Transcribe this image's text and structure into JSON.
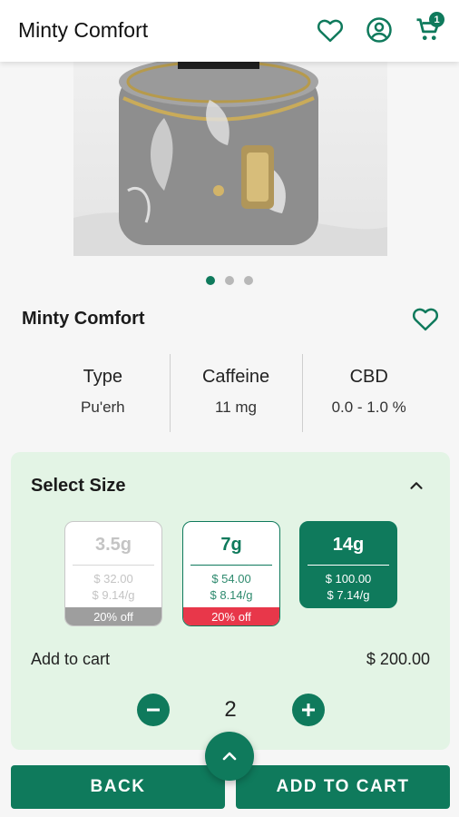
{
  "header": {
    "title": "Minty Comfort",
    "cart_count": "1"
  },
  "icons": {
    "favorite": "heart-icon",
    "account": "account-circle-icon",
    "cart": "cart-icon"
  },
  "gallery": {
    "slides": 3,
    "active_index": 0
  },
  "product": {
    "name": "Minty Comfort",
    "specs": [
      {
        "label": "Type",
        "value": "Pu'erh"
      },
      {
        "label": "Caffeine",
        "value": "11 mg"
      },
      {
        "label": "CBD",
        "value": "0.0 - 1.0 %"
      }
    ]
  },
  "size_selector": {
    "title": "Select Size",
    "options": [
      {
        "weight": "3.5g",
        "price": "$ 32.00",
        "unit_price": "$ 9.14/g",
        "badge": "20% off",
        "state": "disabled"
      },
      {
        "weight": "7g",
        "price": "$ 54.00",
        "unit_price": "$ 8.14/g",
        "badge": "20% off",
        "state": "available"
      },
      {
        "weight": "14g",
        "price": "$ 100.00",
        "unit_price": "$ 7.14/g",
        "badge": "",
        "state": "selected"
      }
    ],
    "add_to_cart_label": "Add to cart",
    "total": "$ 200.00",
    "quantity": "2"
  },
  "footer": {
    "back_label": "BACK",
    "add_label": "ADD TO CART"
  },
  "colors": {
    "accent": "#0f7a5c",
    "panel": "#e3f4e5",
    "discount_red": "#e8374a",
    "discount_grey": "#9e9e9e"
  }
}
